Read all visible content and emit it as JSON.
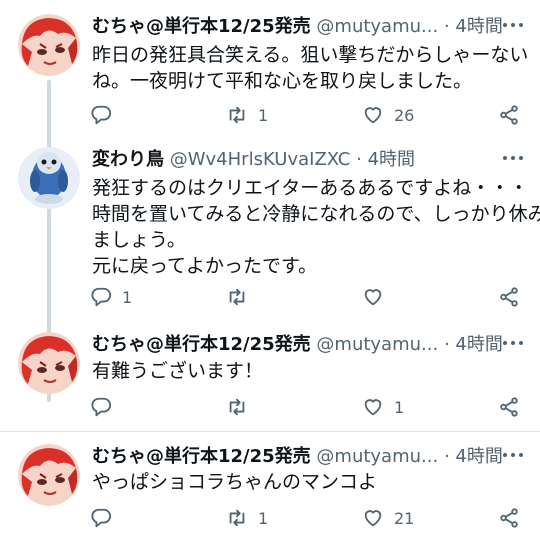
{
  "tweets": [
    {
      "name": "むちゃ@単行本12/25発売",
      "handle": "@mutyamu...",
      "dot": "·",
      "time": "4時間",
      "lines": [
        "昨日の発狂具合笑える。狙い撃ちだからしゃーない",
        "ね。一夜明けて平和な心を取り戻しました。"
      ],
      "reply_count": "",
      "retweet_count": "1",
      "like_count": "26"
    },
    {
      "name": "変わり鳥",
      "handle": "@Wv4HrlsKUvaIZXC",
      "dot": "·",
      "time": "4時間",
      "lines": [
        "発狂するのはクリエイターあるあるですよね・・・",
        "時間を置いてみると冷静になれるので、しっかり休み",
        "ましょう。",
        "元に戻ってよかったです。"
      ],
      "reply_count": "1",
      "retweet_count": "",
      "like_count": ""
    },
    {
      "name": "むちゃ@単行本12/25発売",
      "handle": "@mutyamu...",
      "dot": "·",
      "time": "4時間",
      "lines": [
        "有難うございます！"
      ],
      "reply_count": "",
      "retweet_count": "",
      "like_count": "1"
    },
    {
      "name": "むちゃ@単行本12/25発売",
      "handle": "@mutyamu...",
      "dot": "·",
      "time": "4時間",
      "lines": [
        "やっぱショコラちゃんのマンコよ"
      ],
      "reply_count": "",
      "retweet_count": "1",
      "like_count": "21"
    }
  ],
  "icons": {
    "reply": "reply-icon",
    "retweet": "retweet-icon",
    "like": "heart-icon",
    "share": "share-icon",
    "more": "more-icon"
  },
  "colors": {
    "text": "#0f1419",
    "secondary": "#536471",
    "divider": "#e1e5e8",
    "thread_line": "#cfd9de",
    "avatar_red": "#d9312a",
    "avatar_blue": "#3a6fb8"
  }
}
